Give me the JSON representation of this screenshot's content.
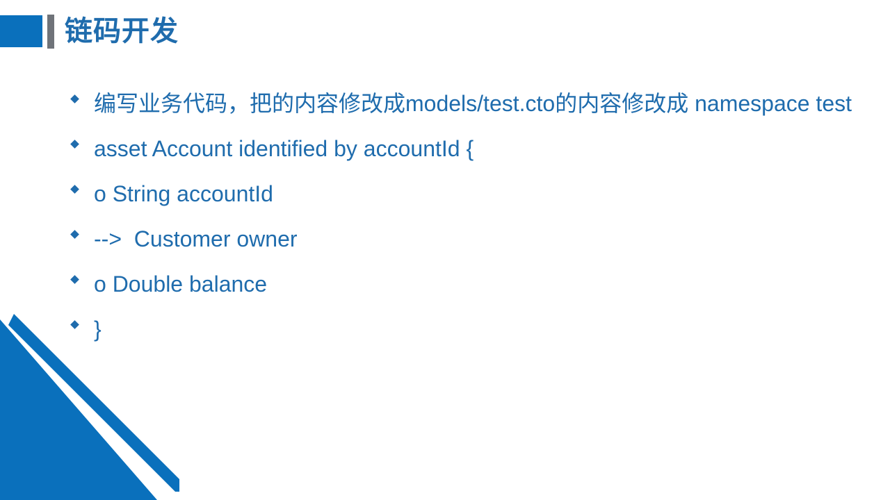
{
  "slide": {
    "title": "链码开发",
    "background_color": "#FFFFFF",
    "accent_color": "#0A70BC",
    "text_color": "#1F6CAD",
    "gray_color": "#6F7379",
    "decor_name": "bottom-left-triangle-decoration"
  },
  "bullets": [
    {
      "text": "编写业务代码，把的内容修改成models/test.cto的内容修改成 namespace test"
    },
    {
      "text": "asset Account identified by accountId {"
    },
    {
      "text": "o String accountId"
    },
    {
      "text": "-->  Customer owner"
    },
    {
      "text": "o Double balance"
    },
    {
      "text": "}"
    }
  ]
}
